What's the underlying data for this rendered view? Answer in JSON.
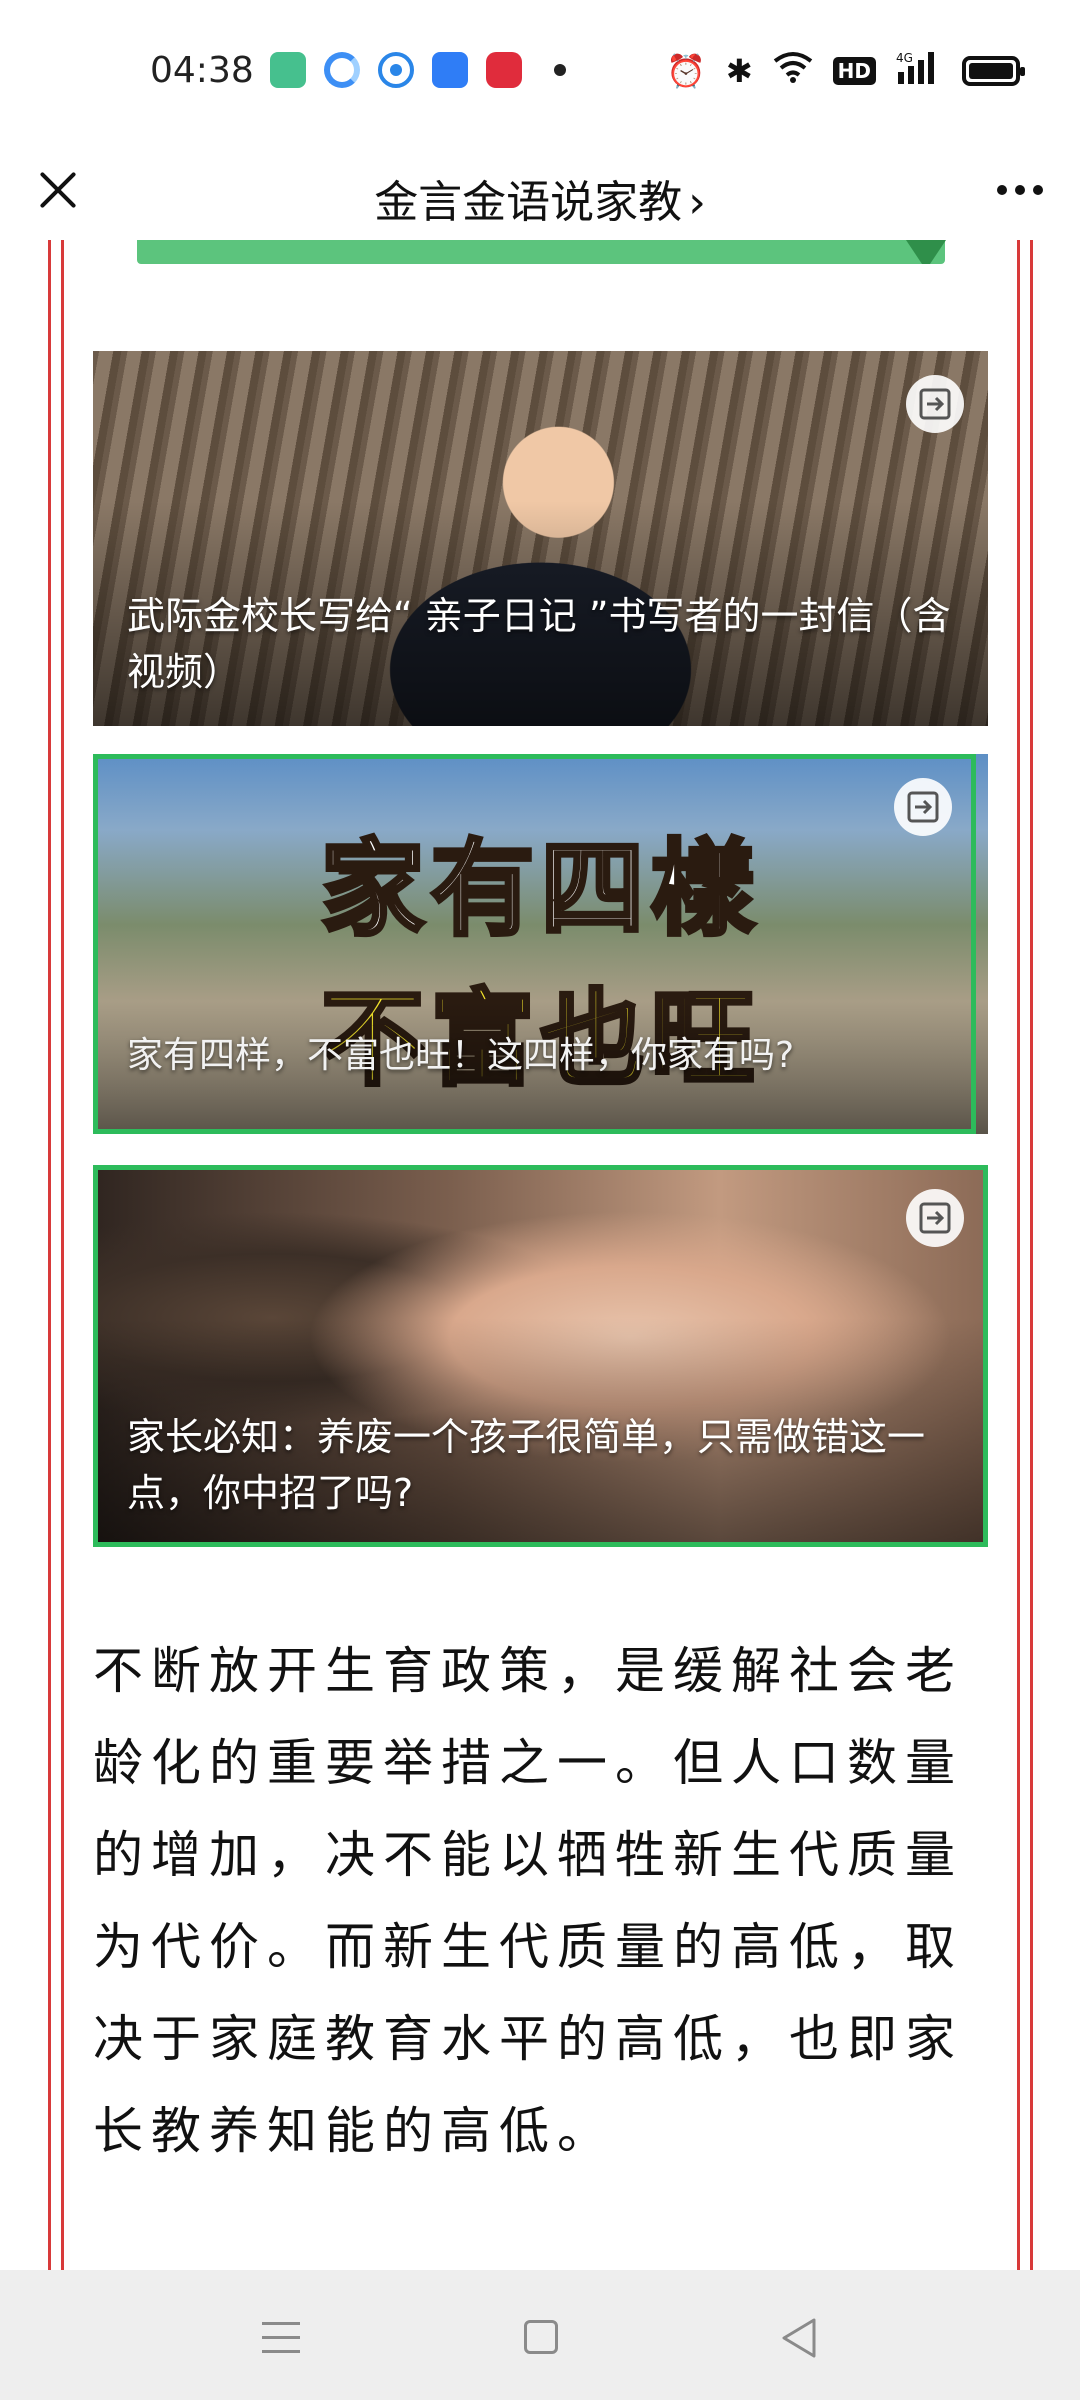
{
  "status_bar": {
    "time": "04:38",
    "app_icons": [
      "green-app-icon",
      "blue-c-app-icon",
      "blue-dot-app-icon",
      "blue-square-app-icon",
      "red-app-icon"
    ],
    "right_icons": [
      "alarm-icon",
      "bluetooth-icon",
      "wifi-icon",
      "hd-icon",
      "signal-4g-icon",
      "battery-icon"
    ],
    "hd_label": "HD",
    "network_label": "4G"
  },
  "title_bar": {
    "title": "金言金语说家教",
    "chevron": "›"
  },
  "cards": [
    {
      "caption": "武际金校长写给“ 亲子日记 ”书写者的一封信（含视频）"
    },
    {
      "overlay_line_1": "家有四樣",
      "overlay_line_2": "不富也旺",
      "caption": "家有四样，不富也旺！这四样，你家有吗?"
    },
    {
      "caption": "家长必知：养废一个孩子很简单，只需做错这一点，你中招了吗?"
    }
  ],
  "article": {
    "paragraph": "不断放开生育政策，是缓解社会老龄化的重要举措之一。但人口数量的增加，决不能以牺牲新生代质量为代价。而新生代质量的高低，取决于家庭教育水平的高低，也即家长教养知能的高低。"
  },
  "colors": {
    "border_red": "#d83a3a",
    "accent_green": "#2dbb5b",
    "nav_bg": "#eeeeee"
  }
}
